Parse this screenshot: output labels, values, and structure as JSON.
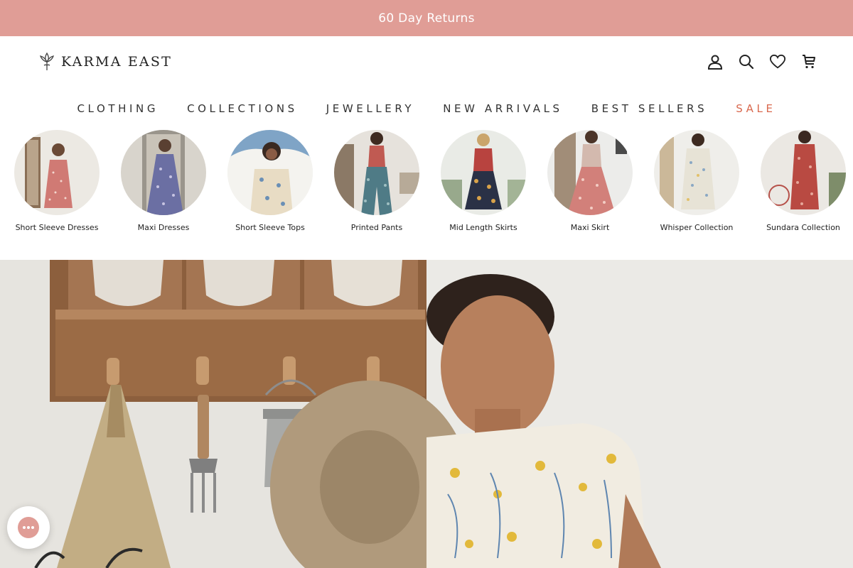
{
  "announcement": {
    "text": "60 Day Returns"
  },
  "brand": {
    "name": "KARMA EAST",
    "logo_icon": "lotus-icon"
  },
  "header_icons": [
    {
      "name": "account-icon"
    },
    {
      "name": "search-icon"
    },
    {
      "name": "wishlist-heart-icon"
    },
    {
      "name": "cart-icon"
    }
  ],
  "nav": {
    "items": [
      {
        "label": "CLOTHING"
      },
      {
        "label": "COLLECTIONS"
      },
      {
        "label": "JEWELLERY"
      },
      {
        "label": "NEW ARRIVALS"
      },
      {
        "label": "BEST SELLERS"
      },
      {
        "label": "SALE"
      }
    ],
    "sale_color": "#d9694f"
  },
  "categories": [
    {
      "label": "Short Sleeve Dresses"
    },
    {
      "label": "Maxi Dresses"
    },
    {
      "label": "Short Sleeve Tops"
    },
    {
      "label": "Printed Pants"
    },
    {
      "label": "Mid Length Skirts"
    },
    {
      "label": "Maxi Skirt"
    },
    {
      "label": "Whisper Collection"
    },
    {
      "label": "Sundara Collection"
    }
  ],
  "colors": {
    "announcement_bg": "#e09d96",
    "accent": "#d9694f"
  },
  "chat": {
    "icon": "chat-bubble-icon"
  }
}
